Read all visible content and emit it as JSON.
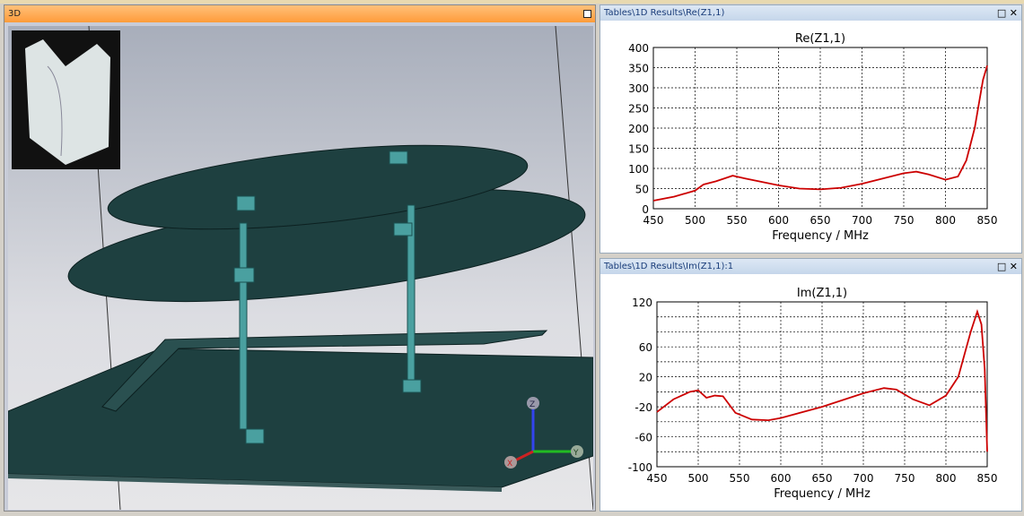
{
  "view3d": {
    "title": "3D"
  },
  "panel_re": {
    "title": "Tables\\1D Results\\Re(Z1,1)"
  },
  "panel_im": {
    "title": "Tables\\1D Results\\Im(Z1,1):1"
  },
  "axis_labels": {
    "x": "Z",
    "y": "Y",
    "z": "X"
  },
  "colors": {
    "curve": "#cc0000",
    "title_active": "#ff9c3a",
    "board": "#1e4040"
  },
  "chart_data": [
    {
      "type": "line",
      "title": "Re(Z1,1)",
      "xlabel": "Frequency / MHz",
      "ylabel": "",
      "xlim": [
        450,
        850
      ],
      "ylim": [
        0,
        400
      ],
      "xticks": [
        450,
        500,
        550,
        600,
        650,
        700,
        750,
        800,
        850
      ],
      "yticks": [
        0,
        50,
        100,
        150,
        200,
        250,
        300,
        350,
        400
      ],
      "grid": true,
      "x": [
        450,
        475,
        500,
        510,
        525,
        535,
        545,
        560,
        600,
        625,
        650,
        675,
        700,
        725,
        750,
        765,
        780,
        800,
        815,
        825,
        835,
        845,
        850
      ],
      "y": [
        20,
        30,
        45,
        60,
        68,
        75,
        82,
        75,
        58,
        50,
        48,
        52,
        62,
        75,
        88,
        92,
        85,
        72,
        80,
        120,
        200,
        320,
        355
      ]
    },
    {
      "type": "line",
      "title": "Im(Z1,1)",
      "xlabel": "Frequency / MHz",
      "ylabel": "",
      "xlim": [
        450,
        850
      ],
      "ylim": [
        -100,
        120
      ],
      "xticks": [
        450,
        500,
        550,
        600,
        650,
        700,
        750,
        800,
        850
      ],
      "yticks": [
        -100,
        -60,
        -20,
        20,
        60,
        120
      ],
      "grid": true,
      "x": [
        450,
        470,
        490,
        500,
        510,
        520,
        530,
        545,
        565,
        585,
        600,
        650,
        700,
        725,
        740,
        760,
        780,
        800,
        815,
        830,
        838,
        843,
        847,
        850
      ],
      "y": [
        -27,
        -10,
        0,
        2,
        -8,
        -5,
        -6,
        -28,
        -37,
        -38,
        -35,
        -20,
        -2,
        5,
        3,
        -10,
        -18,
        -5,
        20,
        80,
        107,
        90,
        30,
        -80
      ]
    }
  ]
}
